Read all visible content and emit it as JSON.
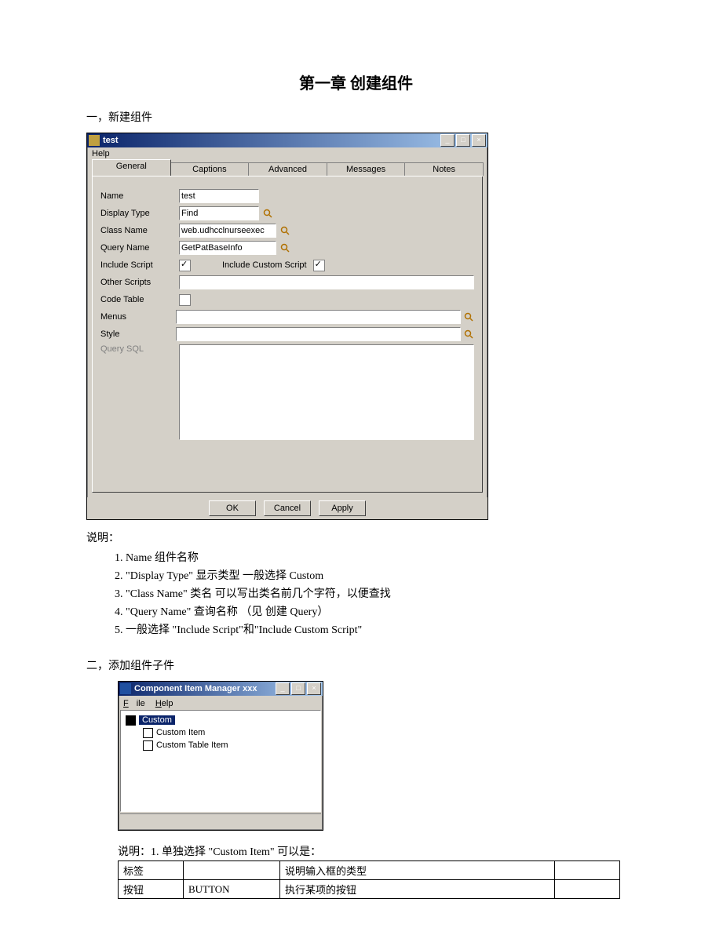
{
  "chapter_title": "第一章  创建组件",
  "section1": "一，新建组件",
  "win1": {
    "title": "test",
    "menu_help": "Help",
    "tabs": [
      "General",
      "Captions",
      "Advanced",
      "Messages",
      "Notes"
    ],
    "labels": {
      "name": "Name",
      "display_type": "Display Type",
      "class_name": "Class Name",
      "query_name": "Query Name",
      "include_script": "Include Script",
      "include_custom_script": "Include Custom Script",
      "other_scripts": "Other Scripts",
      "code_table": "Code Table",
      "menus": "Menus",
      "style": "Style",
      "query_sql": "Query SQL"
    },
    "values": {
      "name": "test",
      "display_type": "Find",
      "class_name": "web.udhcclnurseexec",
      "query_name": "GetPatBaseInfo"
    },
    "buttons": {
      "ok": "OK",
      "cancel": "Cancel",
      "apply": "Apply"
    }
  },
  "explain_label": "说明：",
  "explain_items": [
    "Name    组件名称",
    "\"Display Type\"    显示类型     一般选择 Custom",
    "\"Class Name\"    类名    可以写出类名前几个字符，以便查找",
    "\"Query Name\"    查询名称    （见  创建 Query）",
    "一般选择 \"Include Script\"和\"Include Custom Script\""
  ],
  "section2": "二，添加组件子件",
  "win2": {
    "title": "Component Item Manager xxx",
    "menu_file": "File",
    "menu_help": "Help",
    "tree": {
      "root": "Custom",
      "c1": "Custom Item",
      "c2": "Custom Table Item"
    }
  },
  "explain2": "说明：1.  单独选择 \"Custom Item\" 可以是：",
  "table": {
    "r1c1": "标签",
    "r1c2": "",
    "r1c3": "说明输入框的类型",
    "r1c4": "",
    "r2c1": "按钮",
    "r2c2": "BUTTON",
    "r2c3": "执行某项的按钮",
    "r2c4": ""
  }
}
